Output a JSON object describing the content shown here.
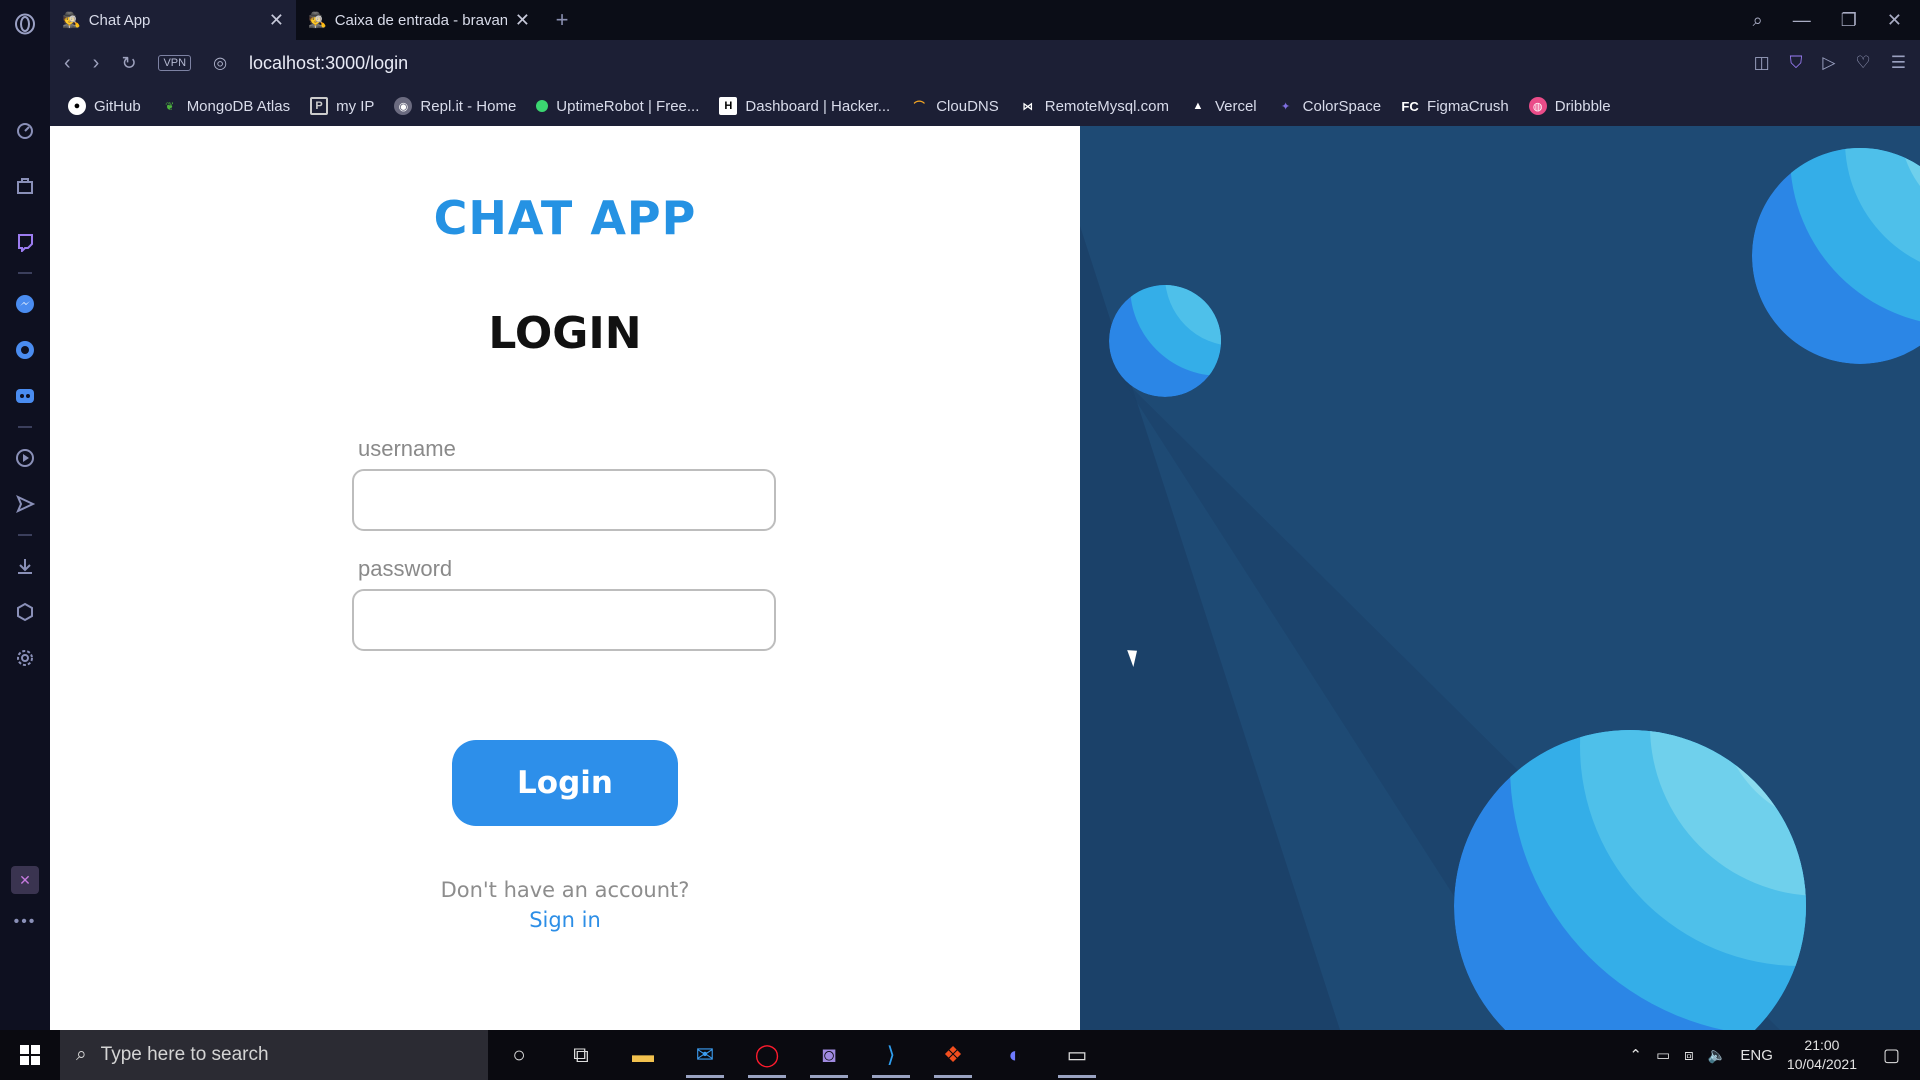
{
  "browser": {
    "tabs": [
      {
        "title": "Chat App",
        "active": true
      },
      {
        "title": "Caixa de entrada - bravand",
        "active": false
      }
    ],
    "url": "localhost:3000/login",
    "vpn_label": "VPN",
    "bookmarks": [
      {
        "label": "GitHub",
        "icon": "github-icon",
        "color": "#ffffff"
      },
      {
        "label": "MongoDB Atlas",
        "icon": "leaf-icon",
        "color": "#4db33d"
      },
      {
        "label": "my IP",
        "icon": "ip-icon",
        "color": "#cccccc"
      },
      {
        "label": "Repl.it - Home",
        "icon": "replit-icon",
        "color": "#9a9ab0"
      },
      {
        "label": "UptimeRobot | Free...",
        "icon": "uptime-icon",
        "color": "#3bd671"
      },
      {
        "label": "Dashboard | Hacker...",
        "icon": "hackerrank-icon",
        "color": "#ffffff"
      },
      {
        "label": "ClouDNS",
        "icon": "cloudns-icon",
        "color": "#f5a623"
      },
      {
        "label": "RemoteMysql.com",
        "icon": "remotemysql-icon",
        "color": "#ffffff"
      },
      {
        "label": "Vercel",
        "icon": "vercel-icon",
        "color": "#ffffff"
      },
      {
        "label": "ColorSpace",
        "icon": "colorspace-icon",
        "color": "#7e6ee0"
      },
      {
        "label": "FigmaCrush",
        "icon": "figmacrush-icon",
        "color": "#ffffff"
      },
      {
        "label": "Dribbble",
        "icon": "dribbble-icon",
        "color": "#ea4c89"
      }
    ]
  },
  "page": {
    "brand": "CHAT APP",
    "title": "LOGIN",
    "username_label": "username",
    "password_label": "password",
    "username_value": "",
    "password_value": "",
    "login_button": "Login",
    "no_account_text": "Don't have an account?",
    "signin_link": "Sign in",
    "colors": {
      "accent": "#2d8fea",
      "right_panel": "#1e4a74"
    }
  },
  "taskbar": {
    "search_placeholder": "Type here to search",
    "language": "ENG",
    "time": "21:00",
    "date": "10/04/2021"
  }
}
